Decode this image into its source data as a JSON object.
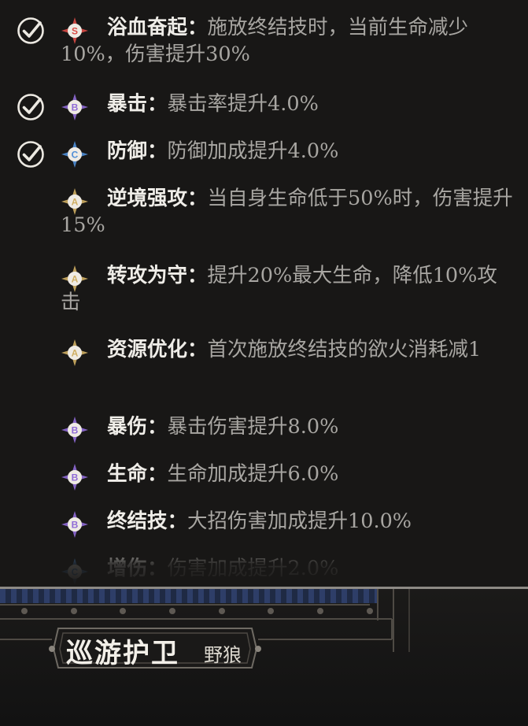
{
  "perks": [
    {
      "checked": true,
      "grade": "S",
      "name": "浴血奋起",
      "sep": "：",
      "desc": "施放终结技时，当前生命减少10%，伤害提升30%"
    },
    {
      "checked": true,
      "grade": "B",
      "name": "暴击",
      "sep": "：",
      "desc": "暴击率提升4.0%"
    },
    {
      "checked": true,
      "grade": "C",
      "name": "防御",
      "sep": "：",
      "desc": "防御加成提升4.0%"
    },
    {
      "checked": false,
      "grade": "A",
      "name": "逆境强攻",
      "sep": "：",
      "desc": "当自身生命低于50%时，伤害提升15%"
    },
    {
      "checked": false,
      "grade": "A",
      "name": "转攻为守",
      "sep": "：",
      "desc": "提升20%最大生命，降低10%攻击"
    },
    {
      "checked": false,
      "grade": "A",
      "name": "资源优化",
      "sep": "：",
      "desc": "首次施放终结技的欲火消耗减1"
    },
    {
      "checked": false,
      "grade": "B",
      "name": "暴伤",
      "sep": "：",
      "desc": "暴击伤害提升8.0%"
    },
    {
      "checked": false,
      "grade": "B",
      "name": "生命",
      "sep": "：",
      "desc": "生命加成提升6.0%"
    },
    {
      "checked": false,
      "grade": "B",
      "name": "终结技",
      "sep": "：",
      "desc": "大招伤害加成提升10.0%"
    },
    {
      "checked": false,
      "grade": "C",
      "name": "增伤",
      "sep": "：",
      "desc": "伤害加成提升2.0%"
    }
  ],
  "grade_colors": {
    "S": "#d94a45",
    "A": "#cfae63",
    "B": "#8f6ad6",
    "C": "#4f8ed6"
  },
  "icons": {
    "check": "check-circle-icon",
    "grade": "grade-diamond-icon"
  },
  "character": {
    "name": "巡游护卫",
    "subtitle": "野狼"
  }
}
